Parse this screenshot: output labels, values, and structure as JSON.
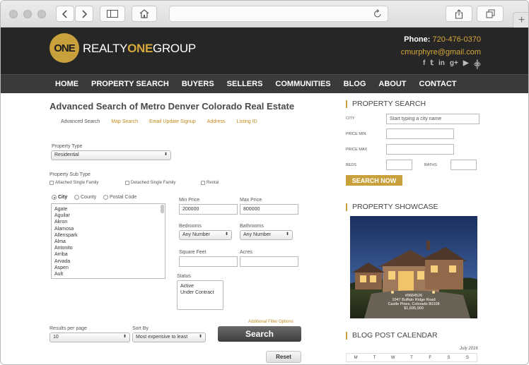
{
  "site": {
    "logo_mark": "ONE",
    "logo_text_prefix": "REALTY",
    "logo_text_bold": "ONE",
    "logo_text_suffix": "GROUP",
    "phone_label": "Phone:",
    "phone_number": "720-476-0370",
    "email": "cmurphyre@gmail.com",
    "social": [
      "f",
      "t",
      "in",
      "g+",
      "yt",
      "rss"
    ]
  },
  "nav": [
    "HOME",
    "PROPERTY SEARCH",
    "BUYERS",
    "SELLERS",
    "COMMUNITIES",
    "BLOG",
    "ABOUT",
    "CONTACT"
  ],
  "main": {
    "title": "Advanced Search of Metro Denver Colorado Real Estate",
    "subtabs": [
      "Advanced Search",
      "Map Search",
      "Email Update Signup",
      "Address",
      "Listing ID"
    ],
    "property_type_label": "Property Type",
    "property_type_value": "Residential",
    "sub_type_label": "Property Sub Type",
    "sub_types": [
      "Attached Single Family",
      "Detached Single Family",
      "Rental"
    ],
    "location_radios": [
      "City",
      "County",
      "Postal Code"
    ],
    "cities": [
      "Agate",
      "Aguilar",
      "Akron",
      "Alamosa",
      "Allenspark",
      "Alma",
      "Antonito",
      "Arriba",
      "Arvada",
      "Aspen",
      "Ault"
    ],
    "min_price_label": "Min Price",
    "min_price_value": "200000",
    "max_price_label": "Max Price",
    "max_price_value": "800000",
    "bedrooms_label": "Bedrooms",
    "bedrooms_value": "Any Number",
    "bathrooms_label": "Bathrooms",
    "bathrooms_value": "Any Number",
    "sqft_label": "Square Feet",
    "acres_label": "Acres",
    "status_label": "Status",
    "status_options": [
      "Active",
      "Under Contract"
    ],
    "filter_link": "Additional Filter Options",
    "results_label": "Results per page",
    "results_value": "10",
    "sort_label": "Sort By",
    "sort_value": "Most expensive to least",
    "search_button": "Search",
    "reset_button": "Reset"
  },
  "sidebar": {
    "property_search_heading": "PROPERTY SEARCH",
    "city_label": "CITY",
    "city_placeholder": "Start typing a city name",
    "price_min_label": "PRICE MIN",
    "price_max_label": "PRICE MAX",
    "beds_label": "BEDS",
    "baths_label": "BATHS",
    "search_now": "SEARCH NOW",
    "showcase_heading": "PROPERTY SHOWCASE",
    "showcase_id": "#9684526",
    "showcase_address1": "1047 Buffalo Ridge Road",
    "showcase_address2": "Castle Pines, Colorado 80108",
    "showcase_price": "$1,695,000",
    "calendar_heading": "BLOG POST CALENDAR",
    "calendar_month": "July 2016",
    "calendar_days": [
      "M",
      "T",
      "W",
      "T",
      "F",
      "S",
      "S"
    ]
  },
  "colors": {
    "gold": "#c9a13c",
    "header_bg": "#262626",
    "nav_bg": "#3a3a3a"
  }
}
